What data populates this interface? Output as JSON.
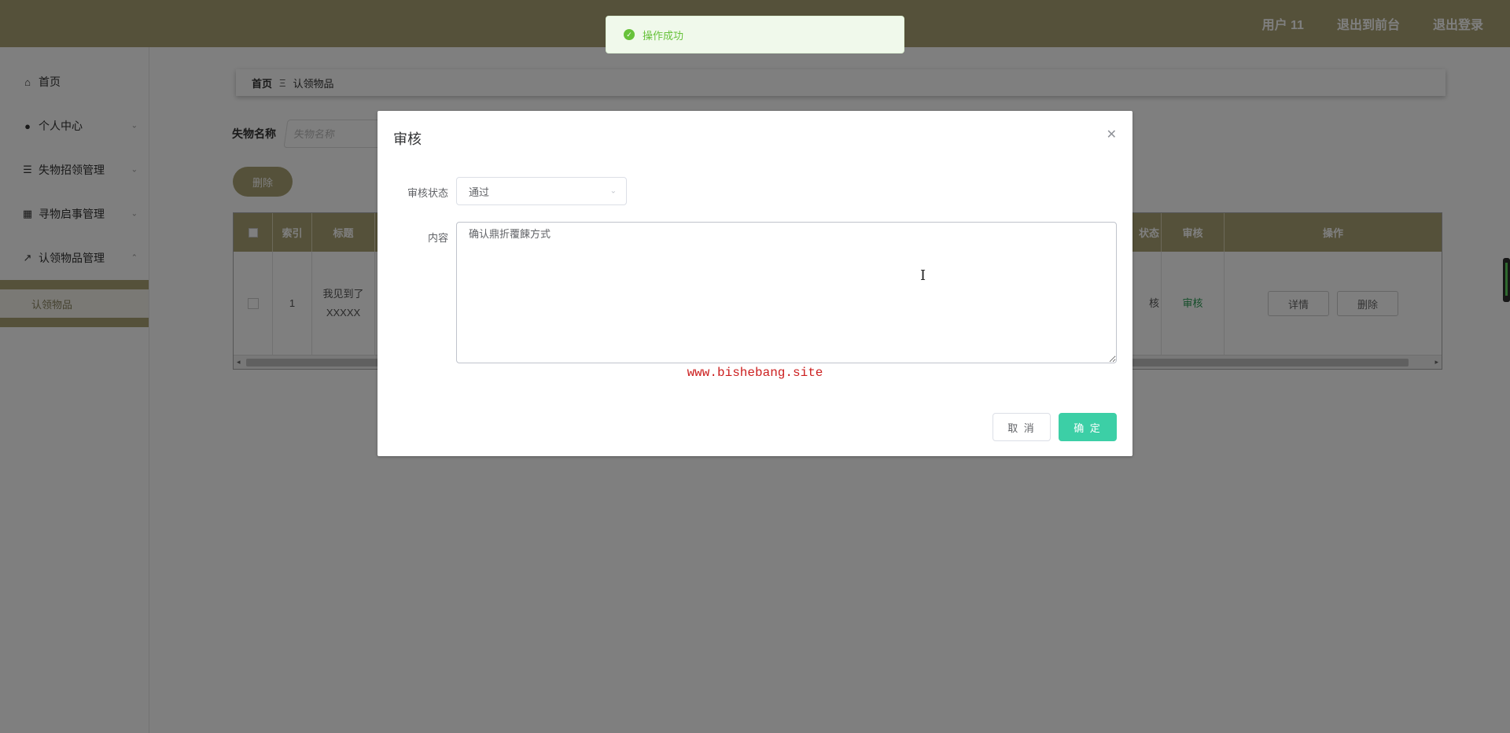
{
  "header": {
    "user": "用户 11",
    "goto_front": "退出到前台",
    "logout": "退出登录"
  },
  "sidebar": {
    "items": [
      {
        "label": "首页",
        "icon": "home-icon"
      },
      {
        "label": "个人中心",
        "icon": "user-icon"
      },
      {
        "label": "失物招领管理",
        "icon": "list-icon"
      },
      {
        "label": "寻物启事管理",
        "icon": "grid-icon"
      },
      {
        "label": "认领物品管理",
        "icon": "chart-icon"
      }
    ],
    "sub_item": "认领物品"
  },
  "breadcrumb": {
    "home": "首页",
    "separator": "Ξ",
    "current": "认领物品"
  },
  "search": {
    "label": "失物名称",
    "placeholder": "失物名称"
  },
  "toolbar": {
    "delete": "删除"
  },
  "table": {
    "headers": {
      "index": "索引",
      "title": "标题",
      "status": "状态",
      "audit": "审核",
      "ops": "操作"
    },
    "row": {
      "index": "1",
      "title": "我见到了XXXXX",
      "status_tail": "核",
      "audit": "审核",
      "detail": "详情",
      "delete": "删除"
    }
  },
  "toast": {
    "message": "操作成功"
  },
  "dialog": {
    "title": "审核",
    "status_label": "审核状态",
    "status_value": "通过",
    "content_label": "内容",
    "content_value": "确认鼎折覆餗方式",
    "watermark": "www.bishebang.site",
    "cancel": "取 消",
    "ok": "确 定"
  },
  "colors": {
    "brand": "#aba374",
    "confirm": "#3ccfa6",
    "toast_success": "#67c23a",
    "watermark": "#cc1f1f"
  }
}
